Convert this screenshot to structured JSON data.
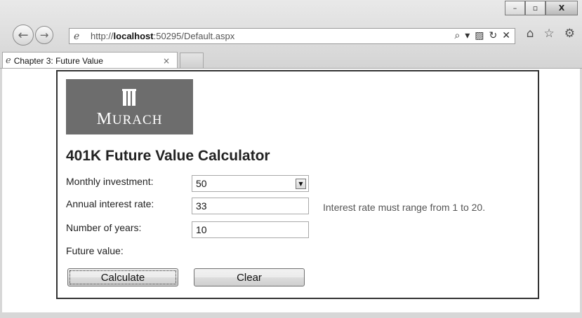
{
  "browser": {
    "url_prefix": "http://",
    "url_host": "localhost",
    "url_rest": ":50295/Default.aspx",
    "tab_title": "Chapter 3: Future Value",
    "tab_close": "×",
    "icons": {
      "back": "back-arrow-icon",
      "forward": "forward-arrow-icon",
      "home": "home-icon",
      "favorites": "star-icon",
      "tools": "gear-icon"
    },
    "window_controls": {
      "minimize": "–",
      "maximize": "▫",
      "close": "X"
    }
  },
  "page": {
    "logo_text_big": "M",
    "logo_text_rest": "URACH",
    "heading": "401K Future Value Calculator",
    "form": {
      "monthly_label": "Monthly investment:",
      "monthly_value": "50",
      "rate_label": "Annual interest rate:",
      "rate_value": "33",
      "rate_error": "Interest rate must range from 1 to 20.",
      "years_label": "Number of years:",
      "years_value": "10",
      "future_label": "Future value:"
    },
    "buttons": {
      "calculate": "Calculate",
      "clear": "Clear"
    }
  }
}
